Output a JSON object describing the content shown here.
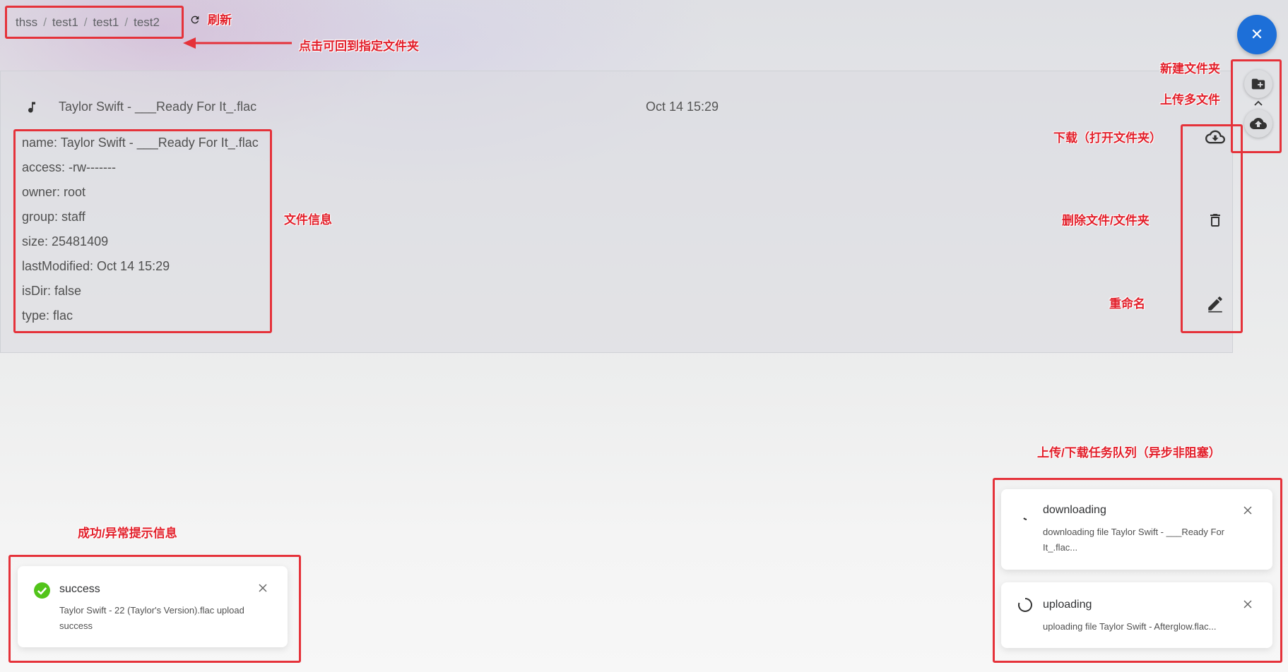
{
  "breadcrumb": [
    "thss",
    "test1",
    "test1",
    "test2"
  ],
  "breadcrumb_separator": "/",
  "file": {
    "name": "Taylor Swift - ___Ready For It_.flac",
    "modified": "Oct 14 15:29",
    "info": [
      "name: Taylor Swift - ___Ready For It_.flac",
      "access: -rw-------",
      "owner: root",
      "group: staff",
      "size: 25481409",
      "lastModified: Oct 14 15:29",
      "isDir: false",
      "type: flac"
    ]
  },
  "fab": {
    "close_glyph": "✕"
  },
  "notifications": {
    "success": {
      "title": "success",
      "message": "Taylor Swift - 22 (Taylor's Version).flac upload success"
    },
    "tasks": [
      {
        "title": "downloading",
        "message": "downloading file Taylor Swift - ___Ready For It_.flac..."
      },
      {
        "title": "uploading",
        "message": "uploading file Taylor Swift - Afterglow.flac..."
      }
    ]
  },
  "annotations": {
    "refresh": "刷新",
    "breadcrumb_hint": "点击可回到指定文件夹",
    "new_folder": "新建文件夹",
    "upload_multi": "上传多文件",
    "download": "下载（打开文件夹）",
    "delete": "删除文件/文件夹",
    "rename": "重命名",
    "file_info": "文件信息",
    "queue": "上传/下载任务队列（异步非阻塞）",
    "messages": "成功/异常提示信息"
  },
  "colors": {
    "accent": "#1d6fd8",
    "annotation": "#e5323a",
    "success": "#52c41a"
  }
}
